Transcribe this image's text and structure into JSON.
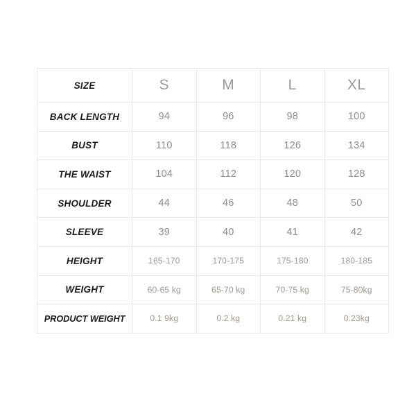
{
  "table": {
    "name": "size-chart",
    "header": {
      "label": "SIZE",
      "sizes": [
        "S",
        "M",
        "L",
        "XL"
      ]
    },
    "rows": [
      {
        "label": "BACK LENGTH",
        "values": [
          "94",
          "96",
          "98",
          "100"
        ],
        "small": false
      },
      {
        "label": "BUST",
        "values": [
          "110",
          "118",
          "126",
          "134"
        ],
        "small": false
      },
      {
        "label": "THE WAIST",
        "values": [
          "104",
          "112",
          "120",
          "128"
        ],
        "small": false
      },
      {
        "label": "SHOULDER",
        "values": [
          "44",
          "46",
          "48",
          "50"
        ],
        "small": false
      },
      {
        "label": "SLEEVE",
        "values": [
          "39",
          "40",
          "41",
          "42"
        ],
        "small": false
      },
      {
        "label": "HEIGHT",
        "values": [
          "165-170",
          "170-175",
          "175-180",
          "180-185"
        ],
        "small": true
      },
      {
        "label": "WEIGHT",
        "values": [
          "60-65 kg",
          "65-70 kg",
          "70-75 kg",
          "75-80kg"
        ],
        "small": true
      },
      {
        "label": "PRODUCT WEIGHT",
        "values": [
          "0.1 9kg",
          "0.2 kg",
          "0.21 kg",
          "0.23kg"
        ],
        "small": true
      }
    ]
  },
  "colors": {
    "background": "#ffffff",
    "border": "#e9e9e9",
    "label_text": "#1b1b1b",
    "size_head_text": "#9a9a9a",
    "value_text": "#8e8e8e",
    "value_small_text": "#a09a96"
  }
}
